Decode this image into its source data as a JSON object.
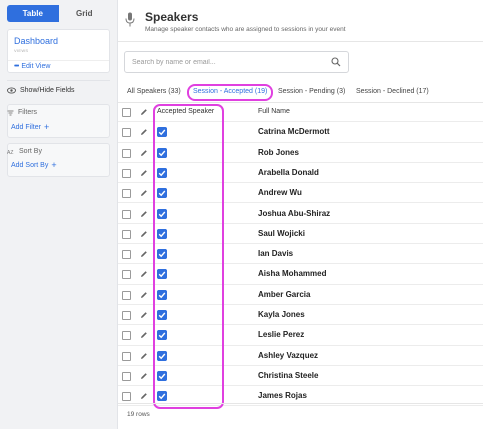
{
  "sidebar": {
    "view_toggle": {
      "table": "Table",
      "grid": "Grid"
    },
    "dashboard": {
      "title": "Dashboard",
      "subtitle": "VIEWS",
      "edit_view": "Edit View"
    },
    "show_hide_fields": "Show/Hide Fields",
    "filters": {
      "label": "Filters",
      "add": "Add Filter"
    },
    "sort": {
      "label": "Sort By",
      "add": "Add Sort By"
    }
  },
  "header": {
    "title": "Speakers",
    "subtitle": "Manage speaker contacts who are assigned to sessions in your event"
  },
  "search": {
    "placeholder": "Search by name or email..."
  },
  "tabs": [
    {
      "label": "All Speakers (33)"
    },
    {
      "label": "Session - Accepted (19)"
    },
    {
      "label": "Session - Pending (3)"
    },
    {
      "label": "Session - Declined (17)"
    }
  ],
  "columns": {
    "accepted": "Accepted Speaker",
    "name": "Full Name"
  },
  "rows": [
    {
      "name": "Catrina McDermott",
      "accepted": true
    },
    {
      "name": "Rob Jones",
      "accepted": true
    },
    {
      "name": "Arabella Donald",
      "accepted": true
    },
    {
      "name": "Andrew Wu",
      "accepted": true
    },
    {
      "name": "Joshua Abu-Shiraz",
      "accepted": true
    },
    {
      "name": "Saul Wojicki",
      "accepted": true
    },
    {
      "name": "Ian Davis",
      "accepted": true
    },
    {
      "name": "Aisha Mohammed",
      "accepted": true
    },
    {
      "name": "Amber Garcia",
      "accepted": true
    },
    {
      "name": "Kayla Jones",
      "accepted": true
    },
    {
      "name": "Leslie Perez",
      "accepted": true
    },
    {
      "name": "Ashley Vazquez",
      "accepted": true
    },
    {
      "name": "Christina Steele",
      "accepted": true
    },
    {
      "name": "James Rojas",
      "accepted": true
    }
  ],
  "footer": {
    "row_count": "19 rows"
  },
  "colors": {
    "accent": "#2f6fde",
    "highlight": "#e040e0"
  }
}
